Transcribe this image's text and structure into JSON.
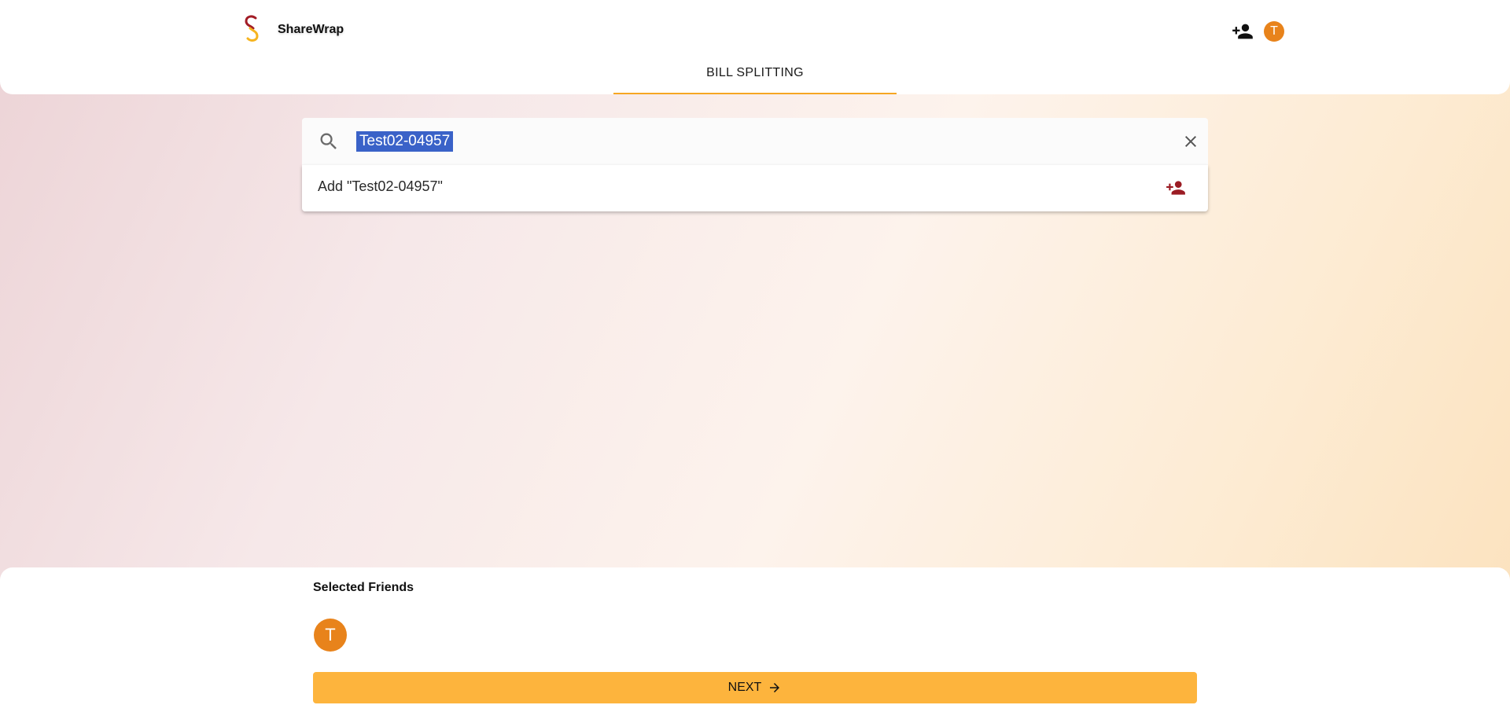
{
  "app": {
    "brand": "ShareWrap"
  },
  "header": {
    "add_friend_icon": "person-add-icon",
    "avatar_initial": "T"
  },
  "tabs": [
    {
      "label": "BILL SPLITTING",
      "active": true
    }
  ],
  "search": {
    "icon": "search-icon",
    "value": "Test02-04957",
    "clear_icon": "close-icon"
  },
  "suggestion": {
    "label": "Add \"Test02-04957\"",
    "icon": "person-add-icon"
  },
  "selected_friends": {
    "title": "Selected Friends",
    "friends": [
      {
        "initial": "T"
      }
    ]
  },
  "next_button": {
    "label": "NEXT",
    "icon": "arrow-right-icon"
  },
  "colors": {
    "accent": "#fdb43d",
    "tab_underline": "#f6a623",
    "avatar": "#e8831b",
    "suggestion_icon": "#9b1c24",
    "selection": "#3a62c8"
  }
}
